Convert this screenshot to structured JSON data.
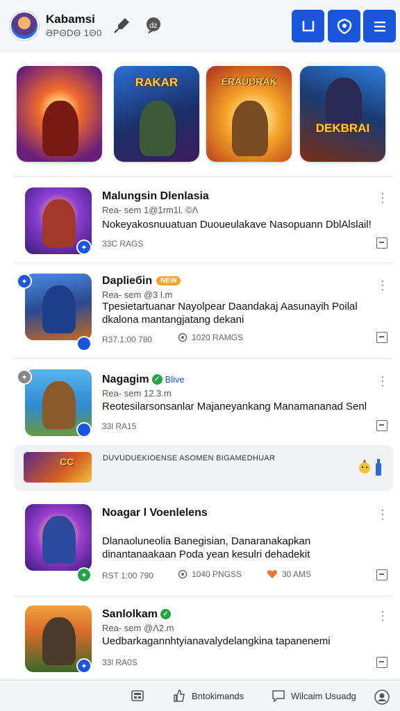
{
  "header": {
    "title": "Kabamsi",
    "subtitle": "ӘPΘDΘ 1Θ0",
    "icon1": "pin-icon",
    "icon2": "chat-icon",
    "buttons": [
      "square-icon",
      "shield-icon",
      "menu-icon"
    ],
    "accent": "#1a56db"
  },
  "featured": [
    {
      "title": "",
      "colors": [
        "#f06a2a",
        "#6a1f7a"
      ]
    },
    {
      "title": "RAKAR",
      "colors": [
        "#2a6fd6",
        "#122a55"
      ]
    },
    {
      "title": "ERAUDRAK",
      "colors": [
        "#f3a228",
        "#b8401c"
      ]
    },
    {
      "title": "DEKBRAI",
      "colors": [
        "#2f7de0",
        "#7a2f16"
      ]
    }
  ],
  "items": [
    {
      "title": "Malungsin Dlenlasia",
      "meta": "Rea- sem 1@1rm1l.   ©Ʌ",
      "desc": "Nokeyakosnuuatuan Duoueulakave Nasopuann DblAlslail!",
      "foot": "33C RAGS",
      "foot2": "",
      "foot3": "",
      "badge": "✦"
    },
    {
      "title": "Daplieбin",
      "tag": "new",
      "meta": "Rea- sem @3 l.m",
      "desc": "Tpesietartuanar Nayolpear Daandakaj Aasunayih Poilal dkalona mantangjatang dekani",
      "foot": "R37.1:00 780",
      "foot2": "1020 RAMGS",
      "foot3": "",
      "badge": "✦"
    },
    {
      "title": "Nagagim",
      "verified": "true",
      "label": "Blive",
      "meta": "Rea- sem 12.3.m",
      "desc": "Reotesilarsonsanlar Majaneyankang Manamananad Senl",
      "foot": "33l RA15",
      "foot2": "",
      "foot3": "",
      "badge": "✦"
    },
    {
      "title": "Noagar l Voenlelens",
      "meta": "",
      "desc": "Dlanaoluneolia Banegisian, Danaranakapkan dinantanaakaan Poda yean kesulri dehadekit",
      "foot": "RST 1:00 790",
      "foot2": "1040 PNGSS",
      "foot3": "30 AMS",
      "badge": "✦"
    },
    {
      "title": "Sanlolkam",
      "verified": "true",
      "meta": "Rea- sem @Ʌ2.m",
      "desc": "Uedbarkagannhtyianavalydelangkina tapanenemi",
      "foot": "33l RA0S",
      "foot2": "",
      "foot3": "",
      "badge": "✦"
    }
  ],
  "banner": {
    "text": "DUVUDUEKIOENSE ASOMEN BIGAMEDHUAR"
  },
  "bottom_nav": [
    {
      "label": "",
      "icon": "news-icon"
    },
    {
      "label": "Bntokimands",
      "icon": "thumbs-up-icon"
    },
    {
      "label": "Wilcaim Usuadg",
      "icon": "chat-bubble-icon"
    },
    {
      "label": "",
      "icon": "profile-icon"
    }
  ]
}
